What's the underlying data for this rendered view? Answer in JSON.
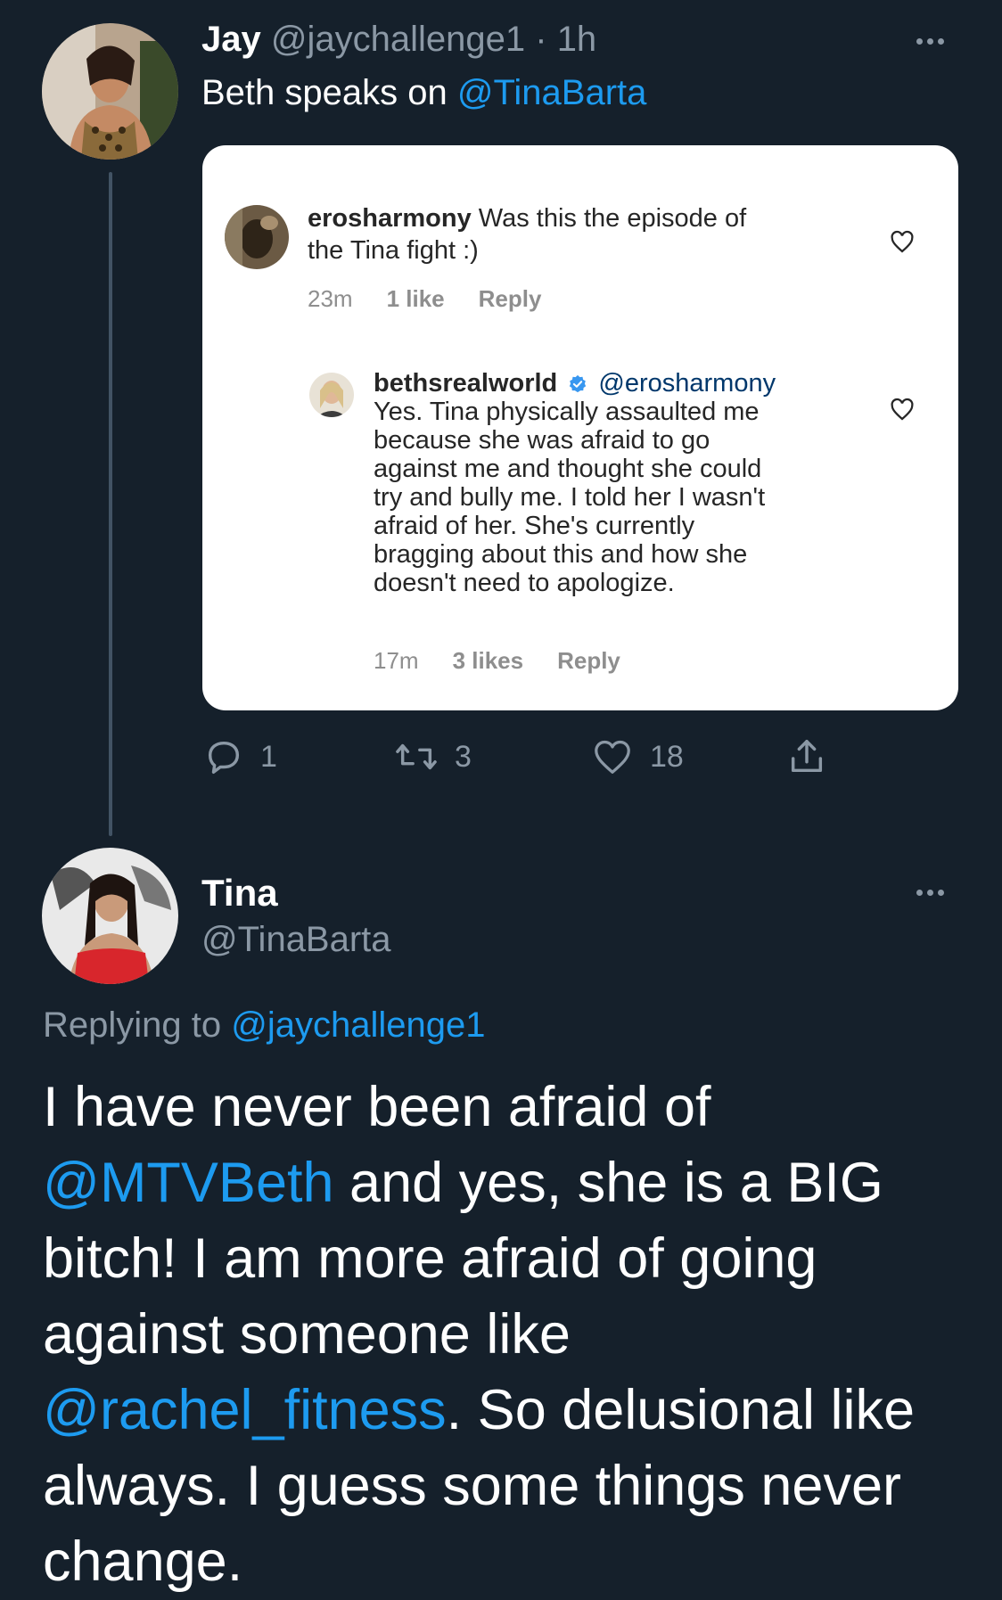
{
  "tweet1": {
    "name": "Jay",
    "handle": "@jaychallenge1",
    "sep": "·",
    "time": "1h",
    "text_prefix": "Beth speaks on ",
    "mention": "@TinaBarta",
    "actions": {
      "reply_count": "1",
      "retweet_count": "3",
      "like_count": "18"
    }
  },
  "embed": {
    "comment1": {
      "user": "erosharmony",
      "text": "Was this the episode of",
      "text2": "the Tina fight :)",
      "time": "23m",
      "likes": "1 like",
      "reply": "Reply"
    },
    "comment2": {
      "user": "bethsrealworld",
      "mention": "@erosharmony",
      "lines": [
        "Yes. Tina physically assaulted me",
        "because she was afraid to go",
        "against me and thought she could",
        "try and bully me. I told her I wasn't",
        "afraid of her. She's currently",
        "bragging about this and how she",
        "doesn't need to apologize."
      ],
      "time": "17m",
      "likes": "3 likes",
      "reply": "Reply"
    }
  },
  "tweet2": {
    "name": "Tina",
    "handle": "@TinaBarta",
    "replying_label": "Replying to ",
    "replying_to": "@jaychallenge1",
    "text": {
      "p1": "I have never been afraid of ",
      "m1": "@MTVBeth",
      "p2": " and yes, she is a BIG bitch!  I am more afraid of going against someone like ",
      "m2": "@rachel_fitness",
      "p3": ".  So delusional like always.  I guess some things never change."
    }
  },
  "colors": {
    "background": "#15202b",
    "link": "#1d9bf0",
    "muted": "#8b98a5",
    "thread_line": "#425364"
  }
}
